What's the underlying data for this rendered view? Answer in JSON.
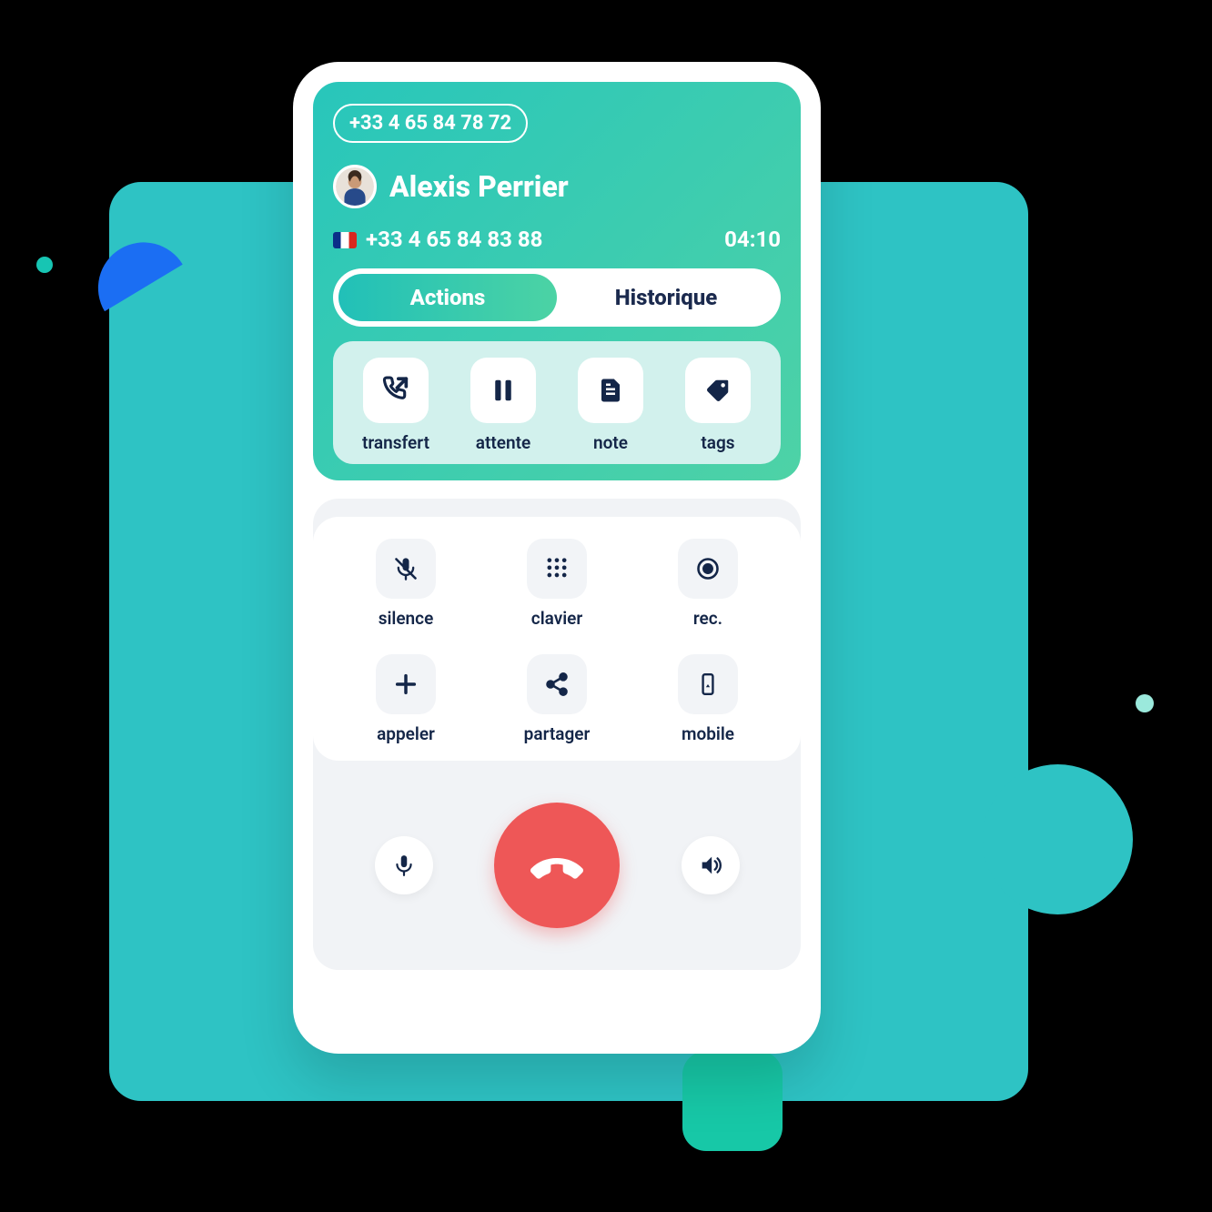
{
  "call": {
    "own_number": "+33 4 65 84 78 72",
    "contact_name": "Alexis Perrier",
    "contact_number": "+33 4 65 84 83 88",
    "duration": "04:10"
  },
  "tabs": {
    "actions": "Actions",
    "history": "Historique"
  },
  "actions": {
    "transfer": "transfert",
    "hold": "attente",
    "note": "note",
    "tags": "tags"
  },
  "controls": {
    "mute": "silence",
    "keypad": "clavier",
    "record": "rec.",
    "call": "appeler",
    "share": "partager",
    "mobile": "mobile"
  }
}
